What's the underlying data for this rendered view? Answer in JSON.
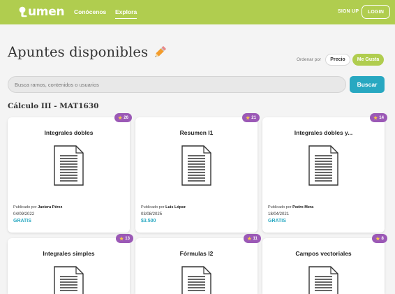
{
  "header": {
    "logo": "umen",
    "nav": [
      "Conócenos",
      "Explora"
    ],
    "signup": "SIGN UP",
    "login": "LOGIN"
  },
  "page": {
    "title": "Apuntes disponibles",
    "order_label": "Ordenar por",
    "order_options": [
      "Precio",
      "Me Gusta"
    ],
    "search_placeholder": "Busca ramos, contenidos o usuarios",
    "search_button": "Buscar",
    "course": "Cálculo III - MAT1630"
  },
  "cards": [
    {
      "title": "Integrales dobles",
      "likes": "26",
      "published_label": "Publicado por",
      "author": "Javiera Pérez",
      "date": "04/09/2022",
      "price": "GRATIS"
    },
    {
      "title": "Resumen I1",
      "likes": "21",
      "published_label": "Publicado por",
      "author": "Luis López",
      "date": "03/08/2025",
      "price": "$3.500"
    },
    {
      "title": "Integrales dobles y...",
      "likes": "14",
      "published_label": "Publicado por",
      "author": "Pedro Mera",
      "date": "18/04/2021",
      "price": "GRATIS"
    },
    {
      "title": "Integrales simples",
      "likes": "13"
    },
    {
      "title": "Fórmulas I2",
      "likes": "11"
    },
    {
      "title": "Campos vectoriales",
      "likes": "8"
    }
  ],
  "colors": {
    "brand_green": "#b0cd4f",
    "accent_blue": "#28a8c1",
    "badge_purple": "#9b59b6"
  },
  "icons": {
    "logo": "lightbulb-icon",
    "title": "pencil-icon",
    "document": "document-icon",
    "likes": "star-icon"
  }
}
